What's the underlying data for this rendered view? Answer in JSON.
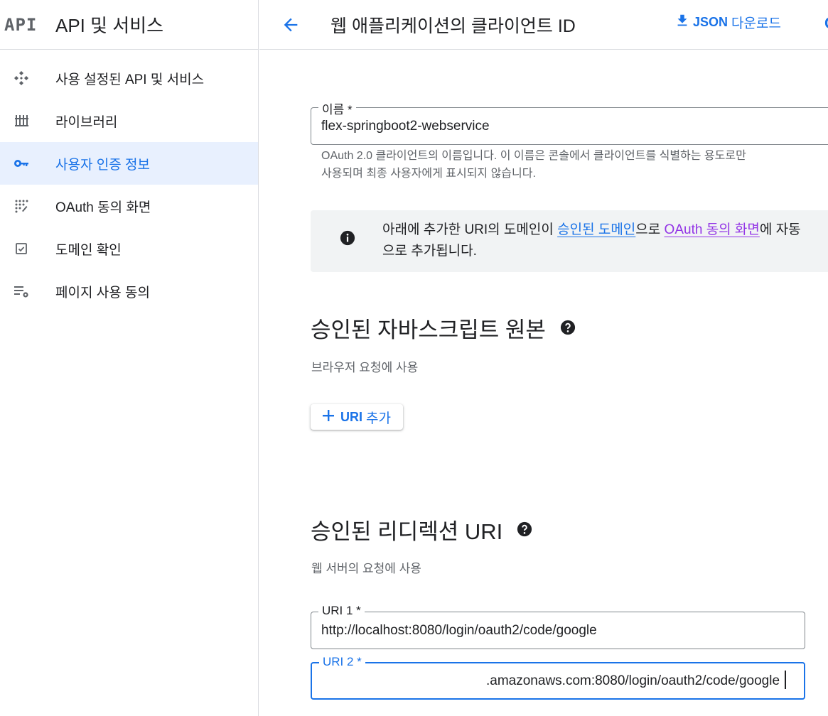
{
  "sidebar": {
    "logo": "API",
    "title": "API 및 서비스",
    "items": [
      {
        "label": "사용 설정된 API 및 서비스",
        "icon": "api-diamond-icon",
        "active": false
      },
      {
        "label": "라이브러리",
        "icon": "library-icon",
        "active": false
      },
      {
        "label": "사용자 인증 정보",
        "icon": "key-icon",
        "active": true
      },
      {
        "label": "OAuth 동의 화면",
        "icon": "dots-grid-icon",
        "active": false
      },
      {
        "label": "도메인 확인",
        "icon": "checkbox-icon",
        "active": false
      },
      {
        "label": "페이지 사용 동의",
        "icon": "list-settings-icon",
        "active": false
      }
    ]
  },
  "header": {
    "title": "웹 애플리케이션의 클라이언트 ID",
    "download_json": "JSON",
    "download_rest": "다운로드"
  },
  "name_field": {
    "label": "이름 *",
    "value": "flex-springboot2-webservice",
    "hint_line1": "OAuth 2.0 클라이언트의 이름입니다. 이 이름은 콘솔에서 클라이언트를 식별하는 용도로만",
    "hint_line2": "사용되며 최종 사용자에게 표시되지 않습니다."
  },
  "notice": {
    "prefix": "아래에 추가한 URI의 도메인이 ",
    "link1": "승인된 도메인",
    "middle": "으로 ",
    "link2": "OAuth 동의 화면",
    "suffix": "에 자동",
    "line2": "으로 추가됩니다."
  },
  "js_origins": {
    "title": "승인된 자바스크립트 원본",
    "subtitle": "브라우저 요청에 사용",
    "add_uri": "URI",
    "add_label": "추가"
  },
  "redirect_uris": {
    "title": "승인된 리디렉션 URI",
    "subtitle": "웹 서버의 요청에 사용",
    "uri1_label": "URI 1 *",
    "uri1_value": "http://localhost:8080/login/oauth2/code/google",
    "uri2_label": "URI 2 *",
    "uri2_value": ".amazonaws.com:8080/login/oauth2/code/google"
  },
  "colors": {
    "accent": "#1a73e8",
    "visited_link": "#9334e6",
    "active_nav_bg": "#e8f0fe",
    "notice_bg": "#f1f3f4"
  }
}
